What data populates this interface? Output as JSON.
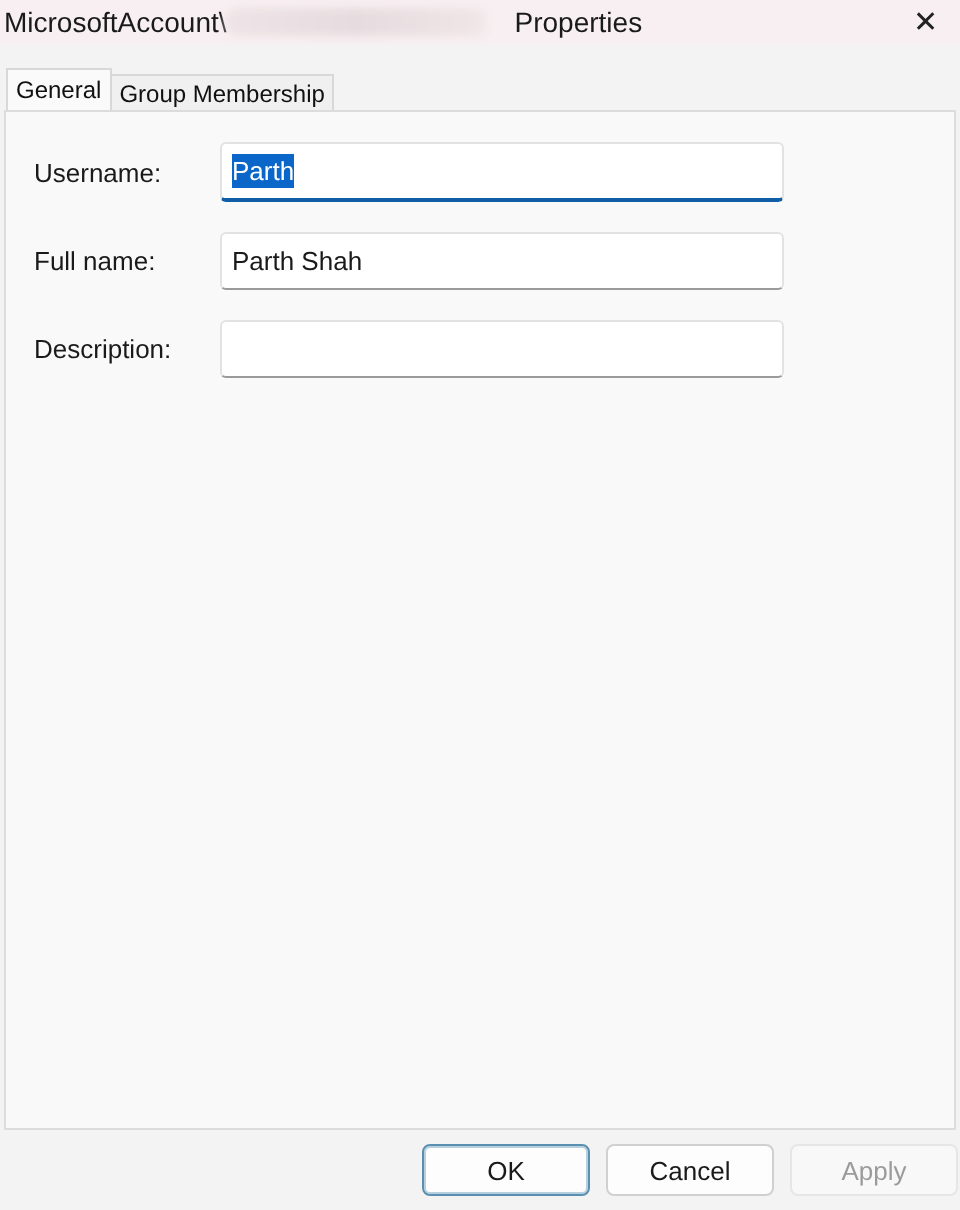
{
  "window": {
    "title_start": "MicrosoftAccount\\",
    "title_end": "Properties",
    "close": "✕"
  },
  "tabs": [
    {
      "label": "General",
      "selected": true
    },
    {
      "label": "Group Membership",
      "selected": false
    }
  ],
  "fields": [
    {
      "label": "Username:",
      "value": "Parth",
      "focused": true,
      "text_selected": true
    },
    {
      "label": "Full name:",
      "value": "Parth Shah",
      "focused": false,
      "text_selected": false
    },
    {
      "label": "Description:",
      "focused": false
    }
  ],
  "buttons": [
    {
      "label": "OK",
      "default": true,
      "disabled": false
    },
    {
      "label": "Cancel",
      "default": false,
      "disabled": false
    },
    {
      "label": "Apply",
      "default": false,
      "disabled": true
    }
  ]
}
